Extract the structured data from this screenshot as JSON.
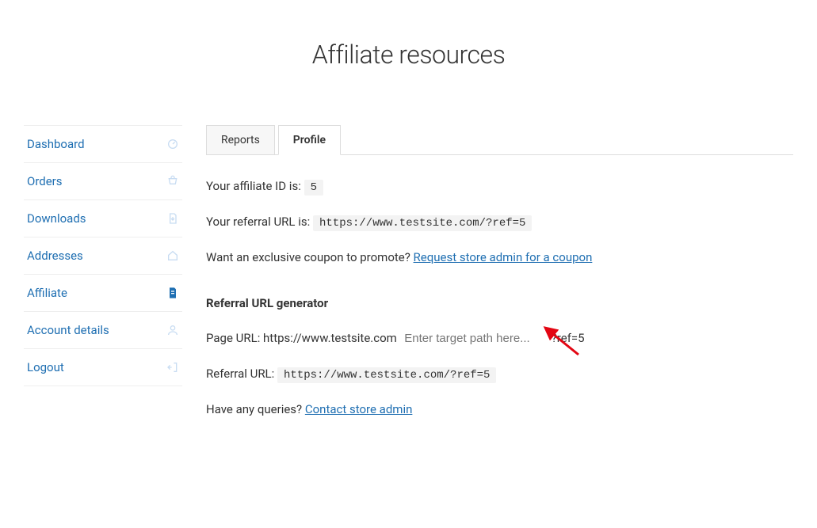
{
  "page_title": "Affiliate resources",
  "sidebar": {
    "items": [
      {
        "label": "Dashboard",
        "icon": "dashboard-icon"
      },
      {
        "label": "Orders",
        "icon": "orders-icon"
      },
      {
        "label": "Downloads",
        "icon": "downloads-icon"
      },
      {
        "label": "Addresses",
        "icon": "addresses-icon"
      },
      {
        "label": "Affiliate",
        "icon": "affiliate-icon"
      },
      {
        "label": "Account details",
        "icon": "account-icon"
      },
      {
        "label": "Logout",
        "icon": "logout-icon"
      }
    ]
  },
  "tabs": {
    "reports": "Reports",
    "profile": "Profile"
  },
  "affiliate_id_label": "Your affiliate ID is:",
  "affiliate_id_value": "5",
  "referral_url_label": "Your referral URL is:",
  "referral_url_value": "https://www.testsite.com/?ref=5",
  "coupon_prompt": "Want an exclusive coupon to promote? ",
  "coupon_link": "Request store admin for a coupon",
  "generator_heading": "Referral URL generator",
  "page_url_label": "Page URL: ",
  "page_url_base": "https://www.testsite.com",
  "path_placeholder": "Enter target path here...",
  "ref_suffix": "?ref=5",
  "gen_referral_label": "Referral URL:",
  "gen_referral_value": "https://www.testsite.com/?ref=5",
  "queries_prompt": "Have any queries? ",
  "queries_link": "Contact store admin"
}
